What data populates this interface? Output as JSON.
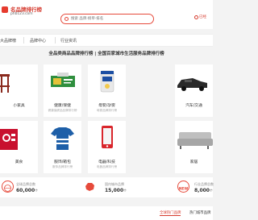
{
  "header": {
    "logo_title": "名品牌排行榜",
    "logo_url": "phb123.com",
    "search_placeholder": "搜索 品牌·榜单·排名",
    "login_label": "已经"
  },
  "nav": {
    "items": [
      "大品牌榜",
      "品牌中心",
      "行业资讯"
    ]
  },
  "headline": "全品类商品品牌排行榜 | 全国百家城市生活服务品牌排行榜",
  "cards": [
    {
      "name": "小家具",
      "sub": "",
      "icon": "chair-icon"
    },
    {
      "name": "健康/保健",
      "sub": "健康保健品品牌排行榜",
      "icon": "health-product-icon"
    },
    {
      "name": "母婴/孕婴",
      "sub": "母婴品牌排行榜",
      "icon": "milk-powder-icon"
    },
    {
      "name": "汽车/交通",
      "sub": "",
      "icon": "car-icon"
    },
    {
      "name": "美食",
      "sub": "",
      "icon": "food-brand-icon"
    },
    {
      "name": "服饰/箱包",
      "sub": "服饰品牌排行榜",
      "icon": "tshirt-icon"
    },
    {
      "name": "电器/科技",
      "sub": "电器品牌排行榜",
      "icon": "phone-icon"
    },
    {
      "name": "家居",
      "sub": "",
      "icon": "sofa-icon"
    }
  ],
  "stats": [
    {
      "label": "全球品牌总数",
      "value": "60,000",
      "unit": "个",
      "icon": "globe-icon"
    },
    {
      "label": "国内城市品牌",
      "value": "15,000",
      "unit": "个",
      "icon": "china-map-icon"
    },
    {
      "label": "行业品牌总数",
      "value": "8,000",
      "unit": "个",
      "icon": "new-badge-icon"
    }
  ],
  "footer": {
    "links": [
      "全球热门品牌",
      "热门城市品牌"
    ]
  },
  "colors": {
    "brand_red": "#d63b2d",
    "page_bg": "#f3f3f3"
  }
}
